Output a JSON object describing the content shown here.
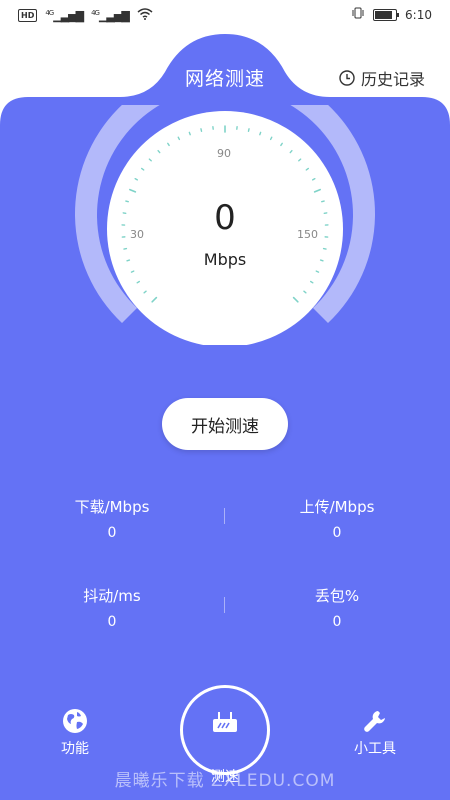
{
  "status_bar": {
    "hd": "HD",
    "net1": "4G",
    "net2": "4G",
    "time": "6:10"
  },
  "header": {
    "title": "网络测速",
    "history_label": "历史记录"
  },
  "gauge": {
    "value": "0",
    "unit": "Mbps",
    "tick_labels": {
      "left": "30",
      "top": "90",
      "right": "150"
    }
  },
  "start_button": {
    "label": "开始测速"
  },
  "stats": {
    "download": {
      "label": "下载/Mbps",
      "value": "0"
    },
    "upload": {
      "label": "上传/Mbps",
      "value": "0"
    },
    "jitter": {
      "label": "抖动/ms",
      "value": "0"
    },
    "loss": {
      "label": "丢包%",
      "value": "0"
    }
  },
  "nav": {
    "left": {
      "label": "功能",
      "icon": "globe-icon"
    },
    "center": {
      "label": "测速",
      "icon": "router-icon"
    },
    "right": {
      "label": "小工具",
      "icon": "wrench-icon"
    }
  },
  "watermark": "晨曦乐下载 ZXLEDU.COM",
  "colors": {
    "primary": "#6472F5",
    "gauge_ring": "#B3B9FA",
    "tick": "#7FD3C8"
  }
}
